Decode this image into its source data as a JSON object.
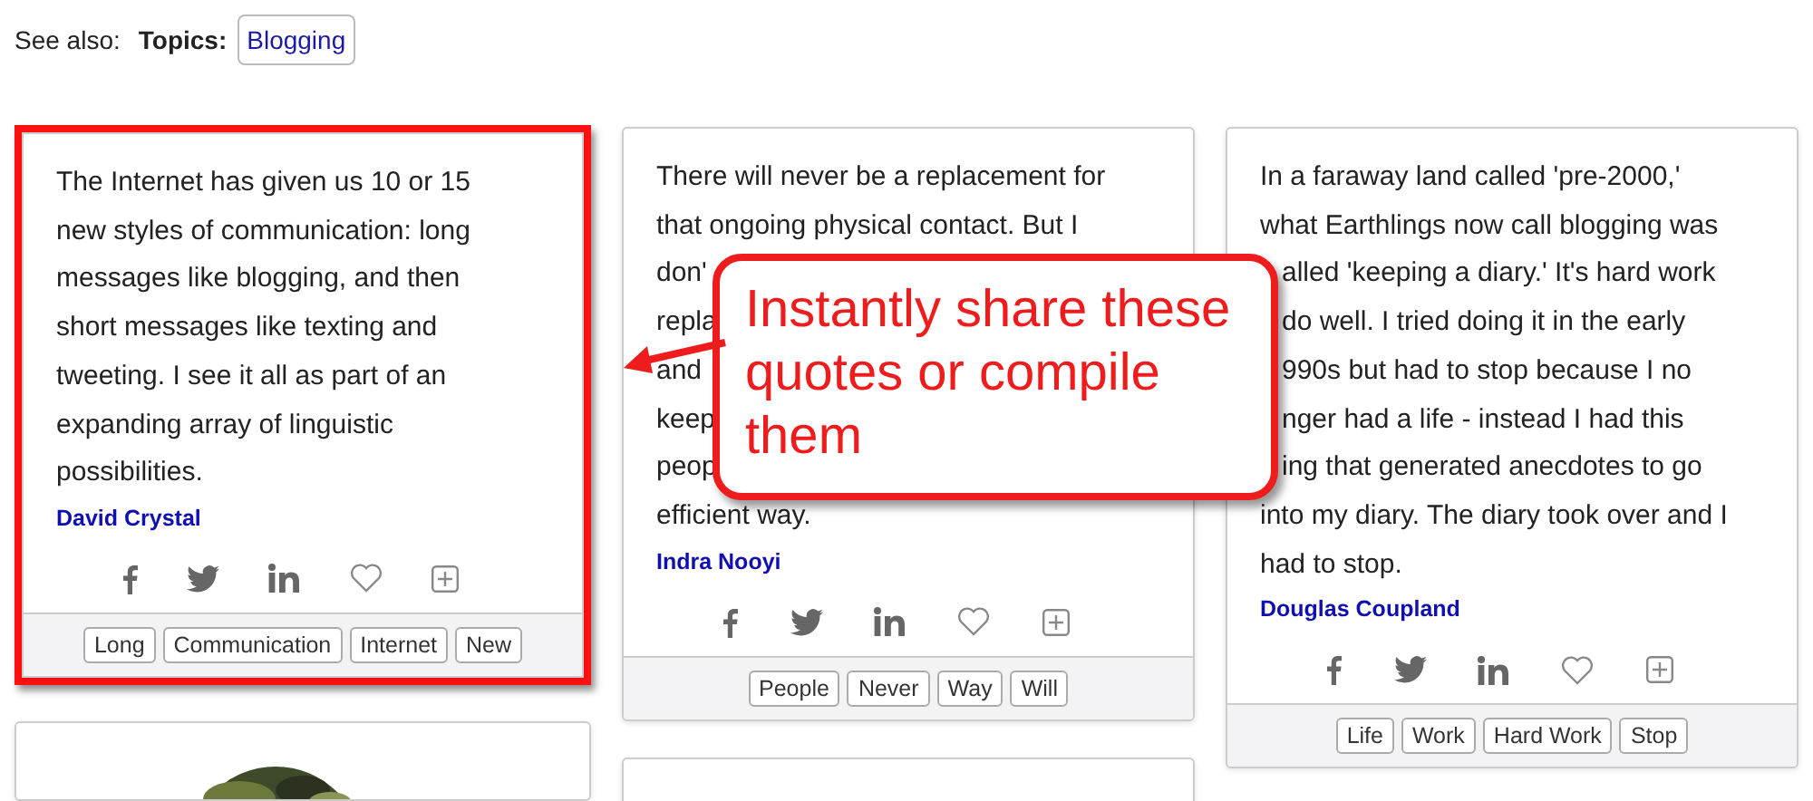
{
  "see_also": {
    "label": "See also:",
    "topics_label": "Topics:",
    "topics": [
      "Blogging"
    ]
  },
  "columns": [
    {
      "cards": [
        {
          "kind": "quote",
          "highlighted": true,
          "lines": [
            {
              "kind": "full",
              "text": "The Internet has given us 10 or 15"
            },
            {
              "kind": "full",
              "text": "new styles of communication: long"
            },
            {
              "kind": "full",
              "text": "messages like blogging, and then"
            },
            {
              "kind": "full",
              "text": "short messages like texting and"
            },
            {
              "kind": "full",
              "text": "tweeting. I see it all as part of an"
            },
            {
              "kind": "full",
              "text": "expanding array of linguistic"
            },
            {
              "kind": "full",
              "text": "possibilities."
            }
          ],
          "author": "David Crystal",
          "tags": [
            "Long",
            "Communication",
            "Internet",
            "New"
          ]
        },
        {
          "kind": "picture"
        }
      ]
    },
    {
      "cards": [
        {
          "kind": "quote",
          "highlighted": false,
          "lines": [
            {
              "kind": "full",
              "text": "There will never be a replacement for"
            },
            {
              "kind": "full",
              "text": "that ongoing physical contact. But I"
            },
            {
              "kind": "full",
              "text": "don'"
            },
            {
              "kind": "full",
              "text": "repla"
            },
            {
              "kind": "full",
              "text": "and"
            },
            {
              "kind": "full",
              "text": "keep"
            },
            {
              "kind": "full",
              "text": "peop"
            },
            {
              "kind": "full",
              "text": "efficient way."
            }
          ],
          "author": "Indra Nooyi",
          "tags": [
            "People",
            "Never",
            "Way",
            "Will"
          ]
        },
        {
          "kind": "blank"
        }
      ]
    },
    {
      "cards": [
        {
          "kind": "quote",
          "highlighted": false,
          "lines": [
            {
              "kind": "full",
              "text": "In a faraway land called 'pre-2000,'"
            },
            {
              "kind": "full",
              "text": "what Earthlings now call blogging was"
            },
            {
              "kind": "cut",
              "text": "alled 'keeping a diary.' It's hard work"
            },
            {
              "kind": "cut",
              "text": "do well. I tried doing it in the early"
            },
            {
              "kind": "cut",
              "text": "990s but had to stop because I no"
            },
            {
              "kind": "cut",
              "text": "nger had a life - instead I had this"
            },
            {
              "kind": "cut",
              "text": "ing that generated anecdotes to go"
            },
            {
              "kind": "full",
              "text": "into my diary. The diary took over and I"
            },
            {
              "kind": "full",
              "text": "had to stop."
            }
          ],
          "author": "Douglas Coupland",
          "tags": [
            "Life",
            "Work",
            "Hard Work",
            "Stop"
          ]
        }
      ]
    }
  ],
  "callout": {
    "text": "Instantly share these quotes or compile them"
  }
}
